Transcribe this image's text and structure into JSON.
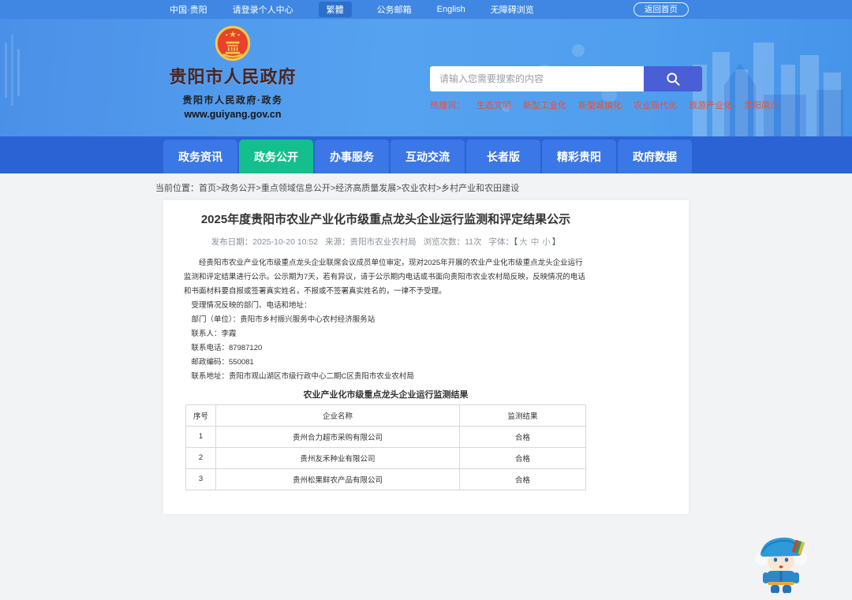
{
  "topbar": {
    "items": [
      "中国·贵阳",
      "请登录个人中心",
      "繁體",
      "公务邮箱",
      "English",
      "无障碍浏览"
    ],
    "home_button": "返回首页"
  },
  "header": {
    "site_name": "贵阳市人民政府",
    "site_subtitle": "贵阳市人民政府·政务",
    "site_url": "www.guiyang.gov.cn",
    "search": {
      "placeholder": "请输入您需要搜索的内容"
    },
    "hot_search_label": "热搜词：",
    "hot_search_items": [
      "生态文明",
      "新型工业化",
      "新型城镇化",
      "农业现代化",
      "旅游产业化",
      "贵阳简介"
    ]
  },
  "nav": {
    "items": [
      {
        "label": "政务资讯",
        "active": false
      },
      {
        "label": "政务公开",
        "active": true
      },
      {
        "label": "办事服务",
        "active": false
      },
      {
        "label": "互动交流",
        "active": false
      },
      {
        "label": "长者版",
        "active": false
      },
      {
        "label": "精彩贵阳",
        "active": false
      },
      {
        "label": "政府数据",
        "active": false
      }
    ]
  },
  "breadcrumb": {
    "label": "当前位置：",
    "path": "首页>政务公开>重点领域信息公开>经济高质量发展>农业农村>乡村产业和农田建设"
  },
  "article": {
    "title": "2025年度贵阳市农业产业化市级重点龙头企业运行监测和评定结果公示",
    "meta": {
      "publish_label": "发布日期：",
      "publish_date": "2025-10-20 10:52",
      "source_label": "来源：",
      "source": "贵阳市农业农村局",
      "views_label": "浏览次数：",
      "views": "11次",
      "font_label": "字体：",
      "font_open": "【",
      "font_sizes": [
        "大",
        "中",
        "小"
      ],
      "font_close": "】"
    },
    "paragraphs": [
      "经贵阳市农业产业化市级重点龙头企业联席会议成员单位审定，现对2025年开展的农业产业化市级重点龙头企业运行监测和评定结果进行公示。公示期为7天，若有异议，请于公示期内电话或书面向贵阳市农业农村局反映，反映情况的电话和书面材料要自报或签署真实姓名，不报或不签署真实姓名的，一律不予受理。",
      "受理情况反映的部门、电话和地址：",
      "部门（单位）：贵阳市乡村振兴服务中心农村经济服务站",
      "联系人：李霞",
      "联系电话：87987120",
      "邮政编码：550081",
      "联系地址：贵阳市观山湖区市级行政中心二期C区贵阳市农业农村局"
    ],
    "table": {
      "caption": "农业产业化市级重点龙头企业运行监测结果",
      "headers": [
        "序号",
        "企业名称",
        "监测结果"
      ],
      "rows": [
        [
          "1",
          "贵州合力超市采购有限公司",
          "合格"
        ],
        [
          "2",
          "贵州友禾种业有限公司",
          "合格"
        ],
        [
          "3",
          "贵州松果鲜农产品有限公司",
          "合格"
        ]
      ]
    }
  },
  "colors": {
    "topbar_blue": "#3f87e3",
    "nav_blue": "#2b63d5",
    "tab_blue": "#3b77e6",
    "active_tab_green": "#13c08d",
    "search_button_blue": "#4a5ed6",
    "hot_search_red": "#e8503a",
    "emblem_red": "#e8412c",
    "emblem_gold": "#f7c948"
  }
}
